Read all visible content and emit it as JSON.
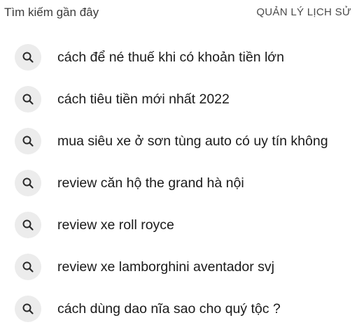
{
  "header": {
    "title": "Tìm kiếm gần đây",
    "manage_history_label": "QUẢN LÝ LỊCH SỬ"
  },
  "recent_searches": [
    {
      "label": "cách để né thuế khi có khoản tiền lớn",
      "icon": "search-icon"
    },
    {
      "label": "cách tiêu tiền mới nhất 2022",
      "icon": "search-icon"
    },
    {
      "label": "mua siêu xe ở sơn tùng auto có uy tín không",
      "icon": "search-icon"
    },
    {
      "label": "review căn hộ the grand hà nội",
      "icon": "search-icon"
    },
    {
      "label": "review xe roll royce",
      "icon": "search-icon"
    },
    {
      "label": "review xe lamborghini aventador svj",
      "icon": "search-icon"
    },
    {
      "label": "cách dùng dao nĩa sao cho quý tộc ?",
      "icon": "search-icon"
    }
  ],
  "colors": {
    "icon_circle_bg": "#ececec",
    "icon_stroke": "#2b2b2b",
    "text": "#1a1a1a"
  }
}
